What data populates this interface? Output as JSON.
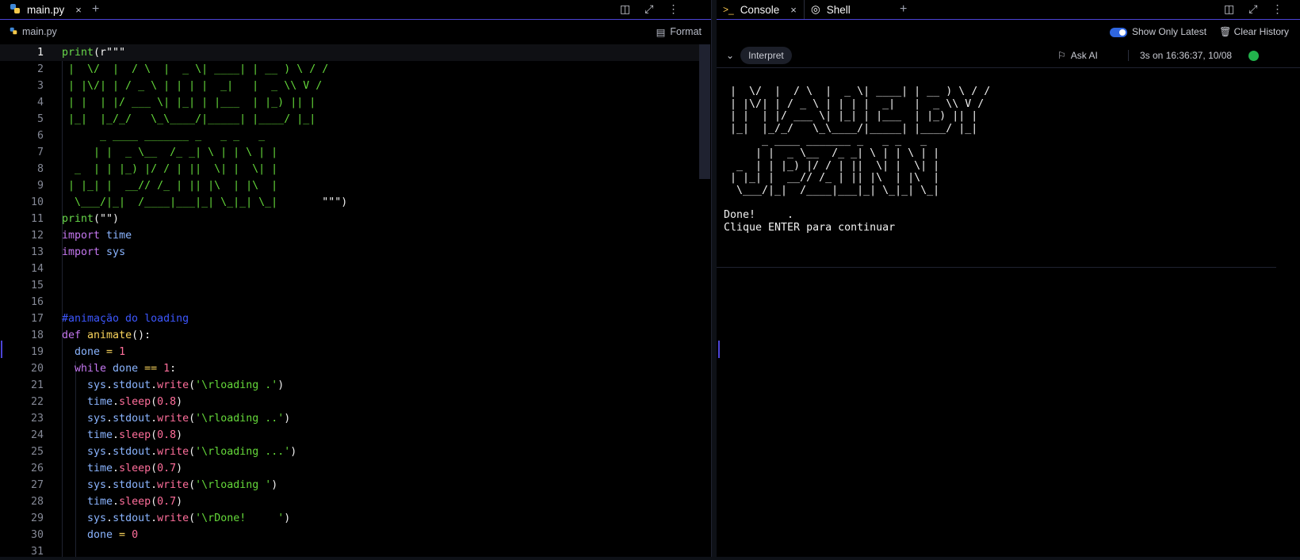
{
  "editor": {
    "tab_label": "main.py",
    "tab_close": "×",
    "new_tab": "+",
    "file_label": "main.py",
    "format_label": "Format",
    "lines": [
      {
        "n": "1",
        "parts": [
          {
            "t": "print",
            "c": "fn"
          },
          {
            "t": "(",
            "c": "w"
          },
          {
            "t": "r\"\"\"",
            "c": "w"
          }
        ]
      },
      {
        "n": "2",
        "parts": [
          {
            "t": " |  \\/  |  / \\  |  _ \\| ____| | __ ) \\ / /",
            "c": "g"
          }
        ]
      },
      {
        "n": "3",
        "parts": [
          {
            "t": " | |\\/| | / _ \\ | | | |  _|   |  _ \\\\ V /",
            "c": "g"
          }
        ]
      },
      {
        "n": "4",
        "parts": [
          {
            "t": " | |  | |/ ___ \\| |_| | |___  | |_) || |",
            "c": "g"
          }
        ]
      },
      {
        "n": "5",
        "parts": [
          {
            "t": " |_|  |_/_/   \\_\\____/|_____| |____/ |_|",
            "c": "g"
          }
        ]
      },
      {
        "n": "6",
        "parts": [
          {
            "t": "      _ ____ _______ _   _ _   _",
            "c": "g"
          }
        ]
      },
      {
        "n": "7",
        "parts": [
          {
            "t": "     | |  _ \\__  /_ _| \\ | | \\ | |",
            "c": "g"
          }
        ]
      },
      {
        "n": "8",
        "parts": [
          {
            "t": "  _  | | |_) |/ / | ||  \\| |  \\| |",
            "c": "g"
          }
        ]
      },
      {
        "n": "9",
        "parts": [
          {
            "t": " | |_| |  __// /_ | || |\\  | |\\  |",
            "c": "g"
          }
        ]
      },
      {
        "n": "10",
        "parts": [
          {
            "t": "  \\___/|_|  /____|___|_| \\_|_| \\_|",
            "c": "g"
          },
          {
            "t": "       \"\"\"",
            "c": "w"
          },
          {
            "t": ")",
            "c": "w"
          }
        ]
      },
      {
        "n": "11",
        "parts": [
          {
            "t": "print",
            "c": "fn"
          },
          {
            "t": "(\"\")",
            "c": "w"
          }
        ]
      },
      {
        "n": "12",
        "parts": [
          {
            "t": "import",
            "c": "k"
          },
          {
            "t": " time",
            "c": "v"
          }
        ]
      },
      {
        "n": "13",
        "parts": [
          {
            "t": "import",
            "c": "k"
          },
          {
            "t": " sys",
            "c": "v"
          }
        ]
      },
      {
        "n": "14",
        "parts": []
      },
      {
        "n": "15",
        "parts": []
      },
      {
        "n": "16",
        "parts": []
      },
      {
        "n": "17",
        "parts": [
          {
            "t": "#animação do loading",
            "c": "c"
          }
        ]
      },
      {
        "n": "18",
        "parts": [
          {
            "t": "def",
            "c": "k"
          },
          {
            "t": " animate",
            "c": "y"
          },
          {
            "t": "():",
            "c": "w"
          }
        ]
      },
      {
        "n": "19",
        "parts": [
          {
            "t": "  done",
            "c": "v"
          },
          {
            "t": " = ",
            "c": "y"
          },
          {
            "t": "1",
            "c": "n"
          }
        ]
      },
      {
        "n": "20",
        "parts": [
          {
            "t": "  while",
            "c": "k"
          },
          {
            "t": " done",
            "c": "v"
          },
          {
            "t": " == ",
            "c": "y"
          },
          {
            "t": "1",
            "c": "n"
          },
          {
            "t": ":",
            "c": "w"
          }
        ]
      },
      {
        "n": "21",
        "parts": [
          {
            "t": "    sys",
            "c": "v"
          },
          {
            "t": ".",
            "c": "w"
          },
          {
            "t": "stdout",
            "c": "v"
          },
          {
            "t": ".",
            "c": "w"
          },
          {
            "t": "write",
            "c": "n"
          },
          {
            "t": "(",
            "c": "w"
          },
          {
            "t": "'\\rloading .'",
            "c": "g"
          },
          {
            "t": ")",
            "c": "w"
          }
        ]
      },
      {
        "n": "22",
        "parts": [
          {
            "t": "    time",
            "c": "v"
          },
          {
            "t": ".",
            "c": "w"
          },
          {
            "t": "sleep",
            "c": "n"
          },
          {
            "t": "(",
            "c": "w"
          },
          {
            "t": "0.8",
            "c": "n"
          },
          {
            "t": ")",
            "c": "w"
          }
        ]
      },
      {
        "n": "23",
        "parts": [
          {
            "t": "    sys",
            "c": "v"
          },
          {
            "t": ".",
            "c": "w"
          },
          {
            "t": "stdout",
            "c": "v"
          },
          {
            "t": ".",
            "c": "w"
          },
          {
            "t": "write",
            "c": "n"
          },
          {
            "t": "(",
            "c": "w"
          },
          {
            "t": "'\\rloading ..'",
            "c": "g"
          },
          {
            "t": ")",
            "c": "w"
          }
        ]
      },
      {
        "n": "24",
        "parts": [
          {
            "t": "    time",
            "c": "v"
          },
          {
            "t": ".",
            "c": "w"
          },
          {
            "t": "sleep",
            "c": "n"
          },
          {
            "t": "(",
            "c": "w"
          },
          {
            "t": "0.8",
            "c": "n"
          },
          {
            "t": ")",
            "c": "w"
          }
        ]
      },
      {
        "n": "25",
        "parts": [
          {
            "t": "    sys",
            "c": "v"
          },
          {
            "t": ".",
            "c": "w"
          },
          {
            "t": "stdout",
            "c": "v"
          },
          {
            "t": ".",
            "c": "w"
          },
          {
            "t": "write",
            "c": "n"
          },
          {
            "t": "(",
            "c": "w"
          },
          {
            "t": "'\\rloading ...'",
            "c": "g"
          },
          {
            "t": ")",
            "c": "w"
          }
        ]
      },
      {
        "n": "26",
        "parts": [
          {
            "t": "    time",
            "c": "v"
          },
          {
            "t": ".",
            "c": "w"
          },
          {
            "t": "sleep",
            "c": "n"
          },
          {
            "t": "(",
            "c": "w"
          },
          {
            "t": "0.7",
            "c": "n"
          },
          {
            "t": ")",
            "c": "w"
          }
        ]
      },
      {
        "n": "27",
        "parts": [
          {
            "t": "    sys",
            "c": "v"
          },
          {
            "t": ".",
            "c": "w"
          },
          {
            "t": "stdout",
            "c": "v"
          },
          {
            "t": ".",
            "c": "w"
          },
          {
            "t": "write",
            "c": "n"
          },
          {
            "t": "(",
            "c": "w"
          },
          {
            "t": "'\\rloading '",
            "c": "g"
          },
          {
            "t": ")",
            "c": "w"
          }
        ]
      },
      {
        "n": "28",
        "parts": [
          {
            "t": "    time",
            "c": "v"
          },
          {
            "t": ".",
            "c": "w"
          },
          {
            "t": "sleep",
            "c": "n"
          },
          {
            "t": "(",
            "c": "w"
          },
          {
            "t": "0.7",
            "c": "n"
          },
          {
            "t": ")",
            "c": "w"
          }
        ]
      },
      {
        "n": "29",
        "parts": [
          {
            "t": "    sys",
            "c": "v"
          },
          {
            "t": ".",
            "c": "w"
          },
          {
            "t": "stdout",
            "c": "v"
          },
          {
            "t": ".",
            "c": "w"
          },
          {
            "t": "write",
            "c": "n"
          },
          {
            "t": "(",
            "c": "w"
          },
          {
            "t": "'\\rDone!     '",
            "c": "g"
          },
          {
            "t": ")",
            "c": "w"
          }
        ]
      },
      {
        "n": "30",
        "parts": [
          {
            "t": "    done",
            "c": "v"
          },
          {
            "t": " = ",
            "c": "y"
          },
          {
            "t": "0",
            "c": "n"
          }
        ]
      },
      {
        "n": "31",
        "parts": []
      }
    ]
  },
  "console": {
    "tab_console": "Console",
    "tab_console_close": "×",
    "tab_shell": "Shell",
    "new_tab": "+",
    "show_only_latest": "Show Only Latest",
    "clear_history": "Clear History",
    "interpret": "Interpret",
    "ask_ai": "Ask AI",
    "timing": "3s on 16:36:37, 10/08",
    "output": " |  \\/  |  / \\  |  _ \\| ____| | __ ) \\ / /\n | |\\/| | / _ \\ | | | |  _|   |  _ \\\\ V /\n | |  | |/ ___ \\| |_| | |___  | |_) || |\n |_|  |_/_/   \\_\\____/|_____| |____/ |_|\n      _ ____ _______ _   _ _   _\n     | |  _ \\__  /_ _| \\ | | \\ | |\n  _  | | |_) |/ / | ||  \\| |  \\| |\n | |_| |  __// /_ | || |\\  | |\\  |\n  \\___/|_|  /____|___|_| \\_|_| \\_|\n\nDone!     .\nClique ENTER para continuar"
  },
  "colors": {
    "accent": "#4b44d6",
    "success": "#22b24c",
    "comment": "#3d57ff"
  }
}
